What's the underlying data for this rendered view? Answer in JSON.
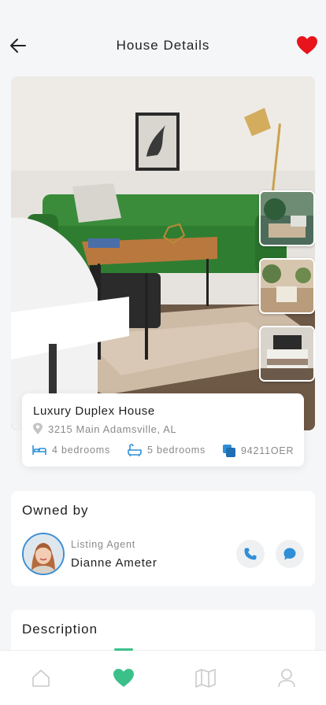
{
  "header": {
    "title": "House Details",
    "back_icon": "arrow-left-icon",
    "favorite_icon": "heart-icon",
    "favorite_color": "#e8141c"
  },
  "gallery": {
    "thumbnail_count": 3,
    "thumbnails": [
      "living-room-plants",
      "balcony-chairs",
      "bedroom"
    ]
  },
  "listing": {
    "name": "Luxury Duplex House",
    "address": "3215 Main Adamsville, AL",
    "features": [
      {
        "icon": "bed-icon",
        "label": "4 bedrooms"
      },
      {
        "icon": "bathtub-icon",
        "label": "5 bedrooms"
      },
      {
        "icon": "id-copy-icon",
        "label": "94211OER"
      }
    ],
    "accent_color": "#2f8fd8"
  },
  "owner": {
    "section_title": "Owned by",
    "role": "Listing Agent",
    "name": "Dianne Ameter",
    "actions": [
      "phone-icon",
      "chat-icon"
    ]
  },
  "description": {
    "section_title": "Description"
  },
  "tabbar": {
    "items": [
      "home-icon",
      "heart-icon",
      "map-icon",
      "profile-icon"
    ],
    "active_index": 1,
    "active_color": "#3cc08a"
  }
}
